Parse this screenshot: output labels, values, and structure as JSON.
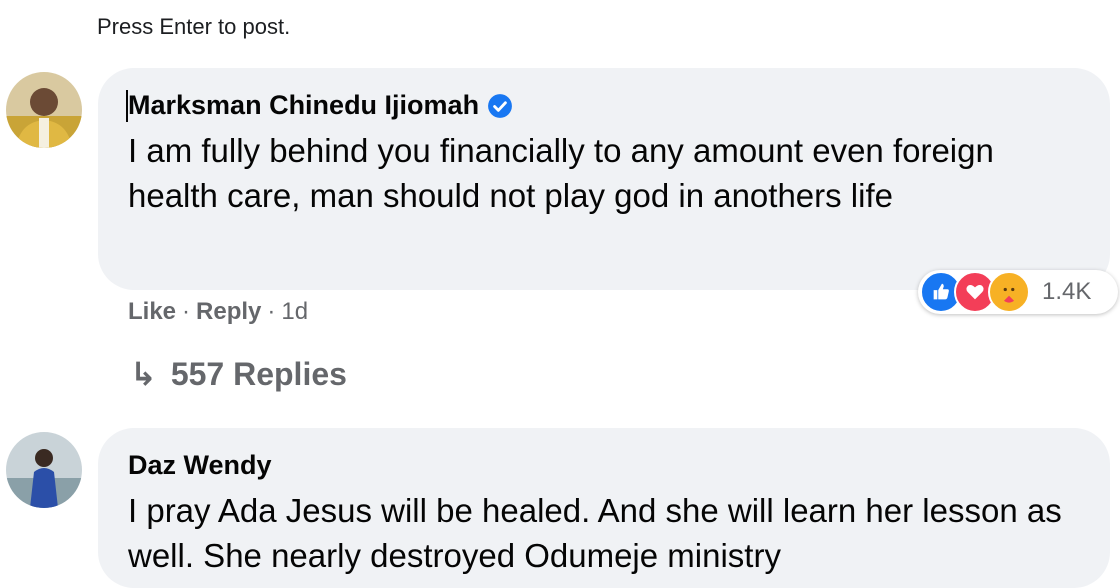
{
  "composer": {
    "hint": "Press Enter to post."
  },
  "comments": [
    {
      "author": "Marksman Chinedu Ijiomah",
      "verified": true,
      "text": "I am fully behind you financially to any amount even foreign health care, man should not play god in anothers life",
      "reactions": {
        "icons": [
          "like-icon",
          "love-icon",
          "care-icon"
        ],
        "count": "1.4K"
      },
      "actions": {
        "like": "Like",
        "reply": "Reply",
        "sep": "·",
        "time": "1d"
      },
      "replies": {
        "arrow": "↳",
        "label": "557 Replies"
      }
    },
    {
      "author": "Daz Wendy",
      "verified": false,
      "text": "I pray Ada Jesus will be healed. And she will learn her lesson as well. She nearly destroyed Odumeje ministry"
    }
  ],
  "colors": {
    "bubble": "#f0f2f5",
    "verified": "#1877f2",
    "muted": "#65676b"
  }
}
